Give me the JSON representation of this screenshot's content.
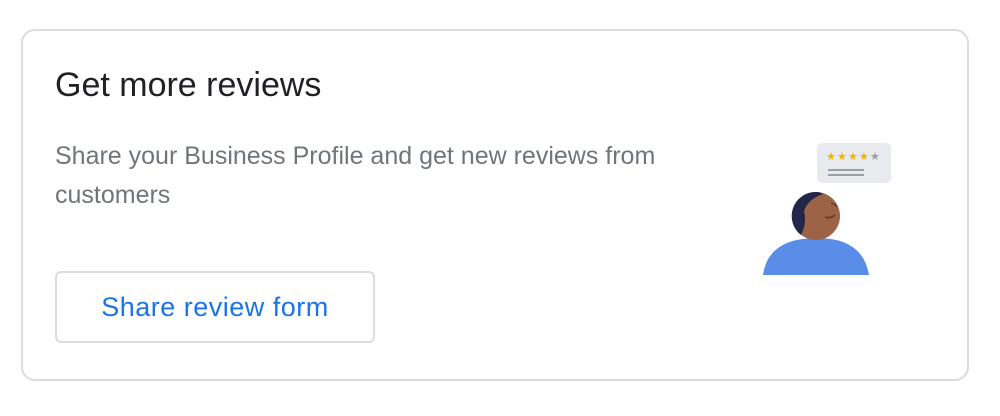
{
  "card": {
    "title": "Get more reviews",
    "description": "Share your Business Profile and get new reviews from customers",
    "button_label": "Share review form"
  },
  "illustration": {
    "rating_stars": 4,
    "max_stars": 5
  },
  "colors": {
    "accent": "#1a73e8",
    "star": "#f4b400",
    "star_empty": "#9aa0a6",
    "person_body": "#5a8de8",
    "skin": "#9c6347",
    "hair": "#222648"
  }
}
